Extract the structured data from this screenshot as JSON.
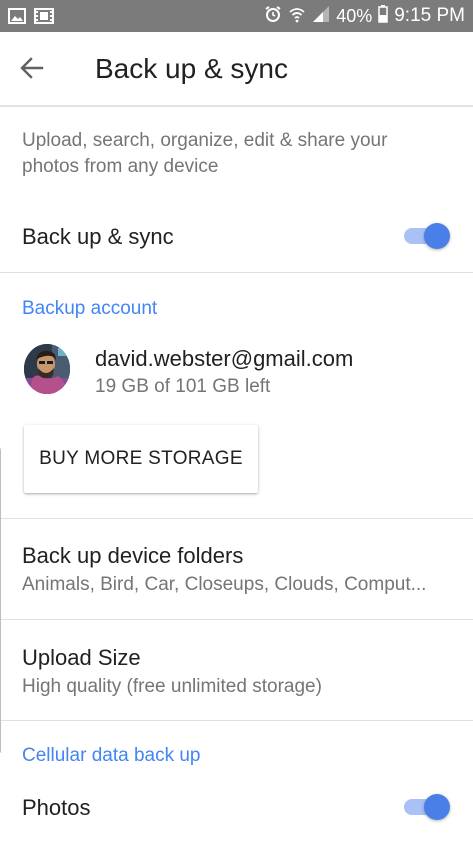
{
  "status_bar": {
    "battery": "40%",
    "time": "9:15 PM",
    "icons": [
      "image-icon",
      "film-icon",
      "alarm-icon",
      "wifi-icon",
      "signal-icon",
      "battery-icon"
    ]
  },
  "app_bar": {
    "back_icon": "arrow-left-icon",
    "title": "Back up & sync"
  },
  "intro": "Upload, search, organize, edit & share your photos from any device",
  "backup_sync": {
    "label": "Back up & sync",
    "enabled": true
  },
  "backup_account": {
    "header": "Backup account",
    "email": "david.webster@gmail.com",
    "storage": "19 GB of 101 GB left",
    "buy_button": "BUY MORE STORAGE"
  },
  "device_folders": {
    "title": "Back up device folders",
    "subtitle": "Animals, Bird, Car, Closeups, Clouds, Comput..."
  },
  "upload_size": {
    "title": "Upload Size",
    "subtitle": "High quality (free unlimited storage)"
  },
  "cellular": {
    "header": "Cellular data back up",
    "photos_label": "Photos",
    "photos_enabled": true
  },
  "colors": {
    "accent": "#4285f4",
    "toggle_thumb": "#4a7fe8",
    "toggle_track": "#a9c2f5",
    "status_bar": "#7b7b7b"
  }
}
